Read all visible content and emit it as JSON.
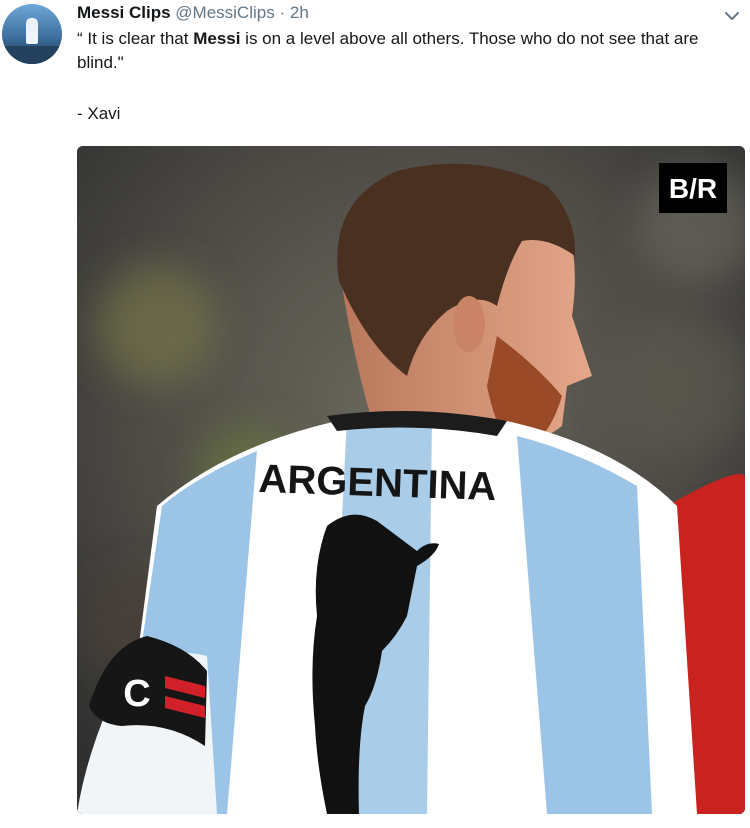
{
  "tweet": {
    "display_name": "Messi Clips",
    "handle": "@MessiClips",
    "separator": "·",
    "time": "2h",
    "text_line1_pre": "“ It is clear that ",
    "text_line1_bold": "Messi",
    "text_line1_post": " is on a level above all others. Those who do not see that are blind.\"",
    "attribution": "- Xavi"
  },
  "media": {
    "logo_text": "B/R",
    "jersey_text": "ARGENTINA",
    "armband_letter": "C"
  },
  "icons": {
    "caret": "chevron-down-icon"
  }
}
